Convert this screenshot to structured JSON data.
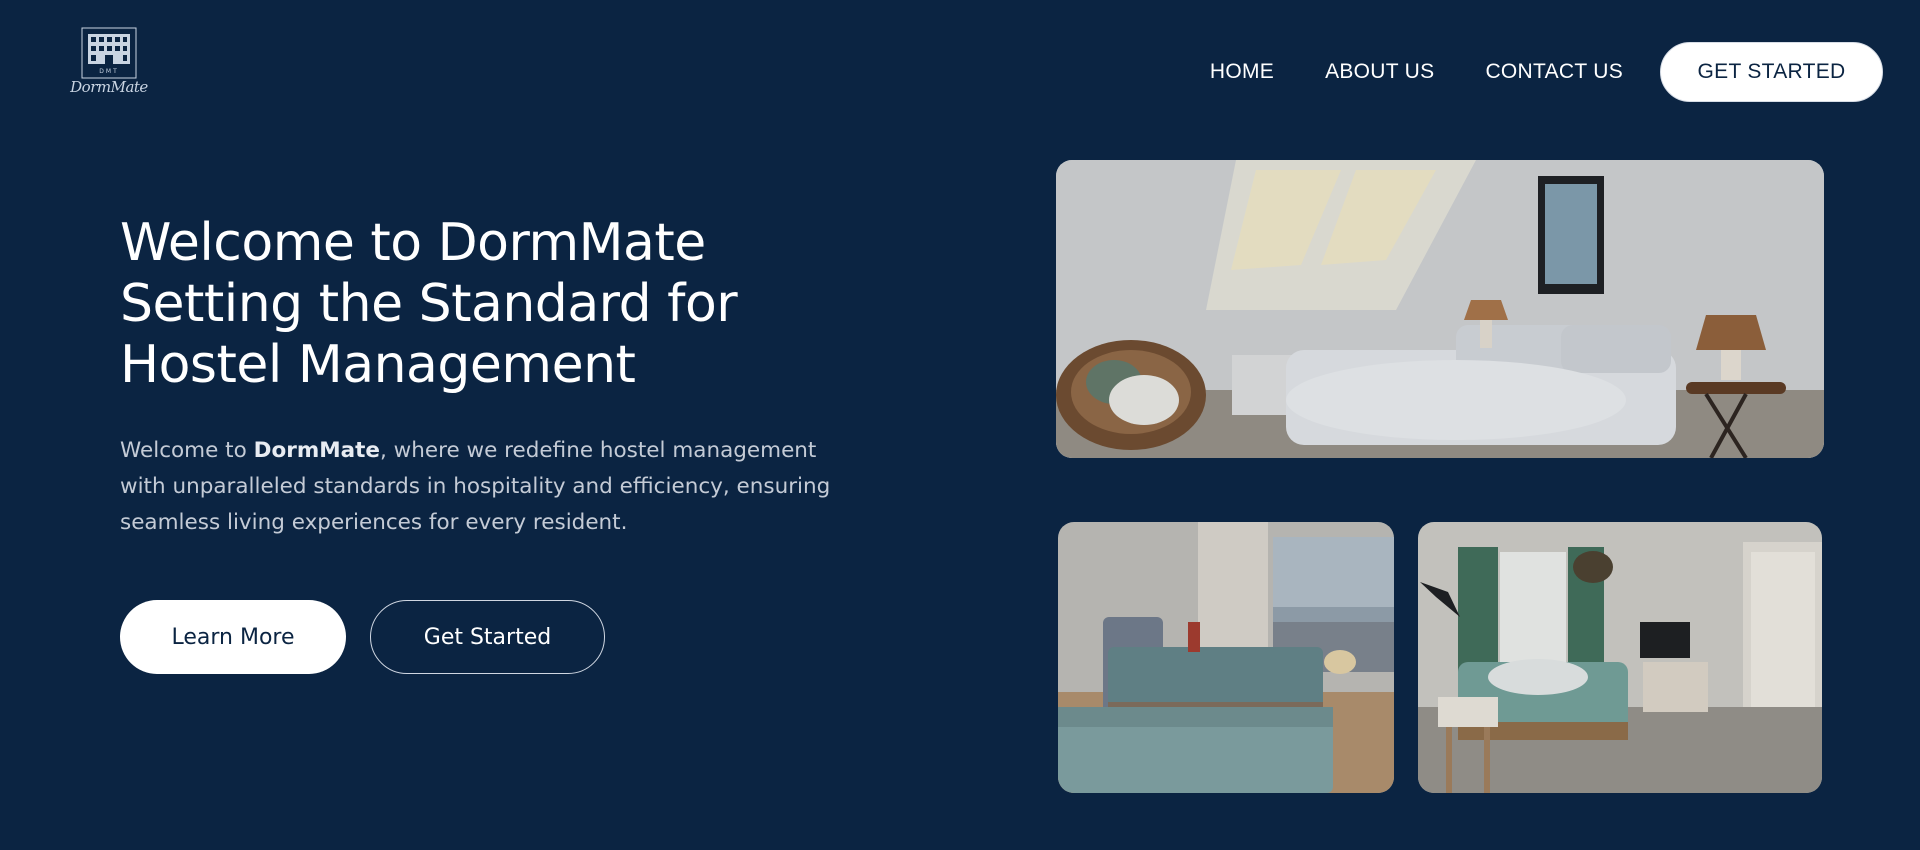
{
  "brand": {
    "logo_icon": "building-icon",
    "logo_letters": "DMT",
    "logo_script": "DormMate"
  },
  "nav": {
    "home": "HOME",
    "about": "ABOUT US",
    "contact": "CONTACT US",
    "cta": "GET STARTED"
  },
  "hero": {
    "title_line1_prefix": "Welcome to ",
    "title_line1_brand": "DormMate",
    "title_line2": "Setting the Standard for",
    "title_line3": "Hostel Management",
    "body_prefix": "Welcome to ",
    "body_brand": "DormMate",
    "body_suffix": ", where we redefine hostel management with unparalleled standards in hospitality and efficiency, ensuring seamless living experiences for every resident.",
    "primary_button": "Learn More",
    "secondary_button": "Get Started"
  },
  "gallery": [
    {
      "subject": "attic bedroom with skylights and lamps"
    },
    {
      "subject": "twin bedroom with city window view"
    },
    {
      "subject": "bedroom with green curtains and TV"
    }
  ],
  "colors": {
    "background": "#0b2442",
    "text": "#ffffff",
    "muted_text": "#c4cbd6",
    "button_fill": "#ffffff"
  }
}
